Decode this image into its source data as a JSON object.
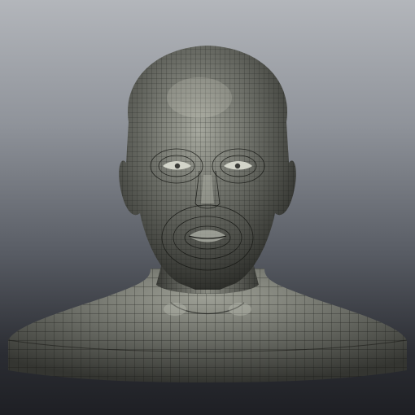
{
  "viewport": {
    "background_top": "#b3b6bb",
    "background_bottom": "#1e1f24"
  },
  "model": {
    "skin_light": "#a4a69c",
    "skin_mid": "#70726b",
    "skin_dark": "#3c3d39",
    "wire_color": "#141512"
  }
}
